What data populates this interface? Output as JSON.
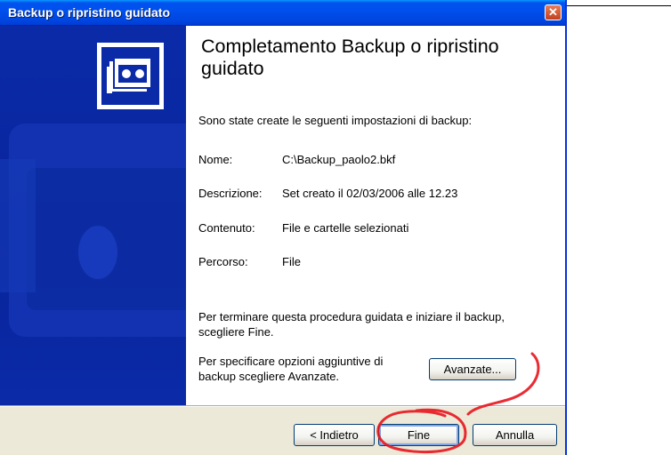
{
  "window": {
    "title": "Backup o ripristino guidato",
    "close_glyph": "✕"
  },
  "wizard": {
    "heading": "Completamento Backup o ripristino guidato",
    "intro": "Sono state create le seguenti impostazioni di backup:",
    "settings": [
      {
        "label": "Nome:",
        "value": "C:\\Backup_paolo2.bkf"
      },
      {
        "label": "Descrizione:",
        "value": "Set creato il 02/03/2006 alle 12.23"
      },
      {
        "label": "Contenuto:",
        "value": "File e cartelle selezionati"
      },
      {
        "label": "Percorso:",
        "value": "File"
      }
    ],
    "finish_note": "Per terminare questa procedura guidata e iniziare il backup, scegliere Fine.",
    "advanced_note": "Per specificare opzioni aggiuntive di backup scegliere Avanzate.",
    "advanced_button": "Avanzate..."
  },
  "buttons": {
    "back": "< Indietro",
    "finish": "Fine",
    "cancel": "Annulla"
  },
  "icons": {
    "banner": "backup-tape-icon",
    "close": "close-icon"
  },
  "colors": {
    "titlebar": "#0053ee",
    "banner": "#0a2aa8",
    "annotation": "#e8141e"
  }
}
